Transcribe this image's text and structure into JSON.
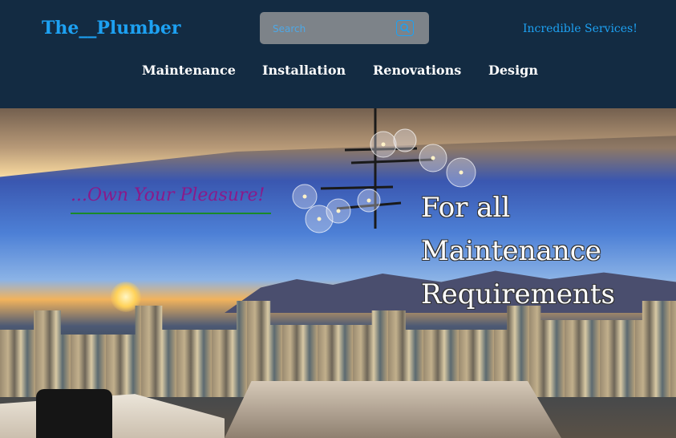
{
  "header": {
    "logo": "The__Plumber",
    "search": {
      "placeholder": "Search",
      "value": ""
    },
    "tagline": "Incredible Services!",
    "nav": [
      {
        "label": "Maintenance"
      },
      {
        "label": "Installation"
      },
      {
        "label": "Renovations"
      },
      {
        "label": "Design"
      }
    ]
  },
  "hero": {
    "slogan": "...Own Your Pleasure!",
    "heading_lines": [
      "For all",
      "Maintenance",
      "Requirements"
    ]
  },
  "colors": {
    "header_bg": "#132b42",
    "accent": "#1da1f2",
    "slogan": "#8a1a8a",
    "underline": "#1a8a2a"
  },
  "icons": {
    "search": "search-icon"
  }
}
